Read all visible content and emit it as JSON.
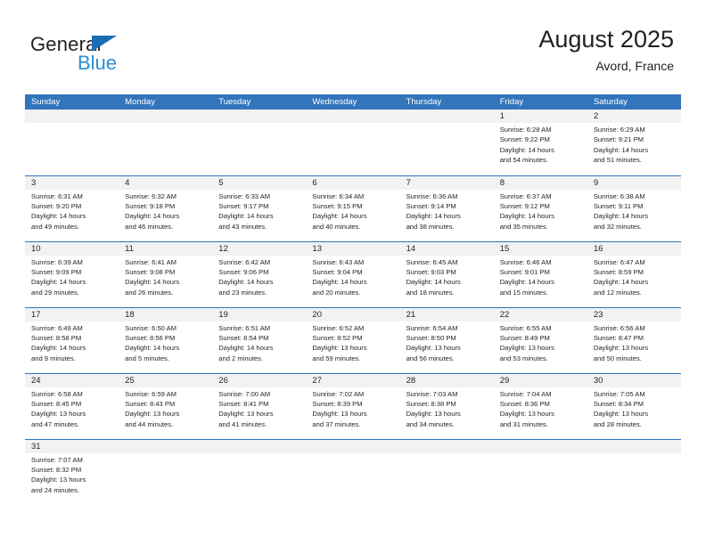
{
  "brand": {
    "name_part1": "General",
    "name_part2": "Blue",
    "accent_color": "#2b8fd4",
    "flag_color": "#1b6cb3"
  },
  "header": {
    "title": "August 2025",
    "subtitle": "Avord, France",
    "header_bg_color": "#3275bb",
    "daynum_band_color": "#f2f2f2"
  },
  "weekday_headers": [
    "Sunday",
    "Monday",
    "Tuesday",
    "Wednesday",
    "Thursday",
    "Friday",
    "Saturday"
  ],
  "weeks": [
    [
      {
        "day": "",
        "empty": true,
        "sunrise": "",
        "sunset": "",
        "daylight_line1": "",
        "daylight_line2": ""
      },
      {
        "day": "",
        "empty": true,
        "sunrise": "",
        "sunset": "",
        "daylight_line1": "",
        "daylight_line2": ""
      },
      {
        "day": "",
        "empty": true,
        "sunrise": "",
        "sunset": "",
        "daylight_line1": "",
        "daylight_line2": ""
      },
      {
        "day": "",
        "empty": true,
        "sunrise": "",
        "sunset": "",
        "daylight_line1": "",
        "daylight_line2": ""
      },
      {
        "day": "",
        "empty": true,
        "sunrise": "",
        "sunset": "",
        "daylight_line1": "",
        "daylight_line2": ""
      },
      {
        "day": "1",
        "empty": false,
        "sunrise": "Sunrise: 6:28 AM",
        "sunset": "Sunset: 9:22 PM",
        "daylight_line1": "Daylight: 14 hours",
        "daylight_line2": "and 54 minutes."
      },
      {
        "day": "2",
        "empty": false,
        "sunrise": "Sunrise: 6:29 AM",
        "sunset": "Sunset: 9:21 PM",
        "daylight_line1": "Daylight: 14 hours",
        "daylight_line2": "and 51 minutes."
      }
    ],
    [
      {
        "day": "3",
        "empty": false,
        "sunrise": "Sunrise: 6:31 AM",
        "sunset": "Sunset: 9:20 PM",
        "daylight_line1": "Daylight: 14 hours",
        "daylight_line2": "and 49 minutes."
      },
      {
        "day": "4",
        "empty": false,
        "sunrise": "Sunrise: 6:32 AM",
        "sunset": "Sunset: 9:18 PM",
        "daylight_line1": "Daylight: 14 hours",
        "daylight_line2": "and 46 minutes."
      },
      {
        "day": "5",
        "empty": false,
        "sunrise": "Sunrise: 6:33 AM",
        "sunset": "Sunset: 9:17 PM",
        "daylight_line1": "Daylight: 14 hours",
        "daylight_line2": "and 43 minutes."
      },
      {
        "day": "6",
        "empty": false,
        "sunrise": "Sunrise: 6:34 AM",
        "sunset": "Sunset: 9:15 PM",
        "daylight_line1": "Daylight: 14 hours",
        "daylight_line2": "and 40 minutes."
      },
      {
        "day": "7",
        "empty": false,
        "sunrise": "Sunrise: 6:36 AM",
        "sunset": "Sunset: 9:14 PM",
        "daylight_line1": "Daylight: 14 hours",
        "daylight_line2": "and 38 minutes."
      },
      {
        "day": "8",
        "empty": false,
        "sunrise": "Sunrise: 6:37 AM",
        "sunset": "Sunset: 9:12 PM",
        "daylight_line1": "Daylight: 14 hours",
        "daylight_line2": "and 35 minutes."
      },
      {
        "day": "9",
        "empty": false,
        "sunrise": "Sunrise: 6:38 AM",
        "sunset": "Sunset: 9:11 PM",
        "daylight_line1": "Daylight: 14 hours",
        "daylight_line2": "and 32 minutes."
      }
    ],
    [
      {
        "day": "10",
        "empty": false,
        "sunrise": "Sunrise: 6:39 AM",
        "sunset": "Sunset: 9:09 PM",
        "daylight_line1": "Daylight: 14 hours",
        "daylight_line2": "and 29 minutes."
      },
      {
        "day": "11",
        "empty": false,
        "sunrise": "Sunrise: 6:41 AM",
        "sunset": "Sunset: 9:08 PM",
        "daylight_line1": "Daylight: 14 hours",
        "daylight_line2": "and 26 minutes."
      },
      {
        "day": "12",
        "empty": false,
        "sunrise": "Sunrise: 6:42 AM",
        "sunset": "Sunset: 9:06 PM",
        "daylight_line1": "Daylight: 14 hours",
        "daylight_line2": "and 23 minutes."
      },
      {
        "day": "13",
        "empty": false,
        "sunrise": "Sunrise: 6:43 AM",
        "sunset": "Sunset: 9:04 PM",
        "daylight_line1": "Daylight: 14 hours",
        "daylight_line2": "and 20 minutes."
      },
      {
        "day": "14",
        "empty": false,
        "sunrise": "Sunrise: 6:45 AM",
        "sunset": "Sunset: 9:03 PM",
        "daylight_line1": "Daylight: 14 hours",
        "daylight_line2": "and 18 minutes."
      },
      {
        "day": "15",
        "empty": false,
        "sunrise": "Sunrise: 6:46 AM",
        "sunset": "Sunset: 9:01 PM",
        "daylight_line1": "Daylight: 14 hours",
        "daylight_line2": "and 15 minutes."
      },
      {
        "day": "16",
        "empty": false,
        "sunrise": "Sunrise: 6:47 AM",
        "sunset": "Sunset: 8:59 PM",
        "daylight_line1": "Daylight: 14 hours",
        "daylight_line2": "and 12 minutes."
      }
    ],
    [
      {
        "day": "17",
        "empty": false,
        "sunrise": "Sunrise: 6:49 AM",
        "sunset": "Sunset: 8:58 PM",
        "daylight_line1": "Daylight: 14 hours",
        "daylight_line2": "and 9 minutes."
      },
      {
        "day": "18",
        "empty": false,
        "sunrise": "Sunrise: 6:50 AM",
        "sunset": "Sunset: 8:56 PM",
        "daylight_line1": "Daylight: 14 hours",
        "daylight_line2": "and 5 minutes."
      },
      {
        "day": "19",
        "empty": false,
        "sunrise": "Sunrise: 6:51 AM",
        "sunset": "Sunset: 8:54 PM",
        "daylight_line1": "Daylight: 14 hours",
        "daylight_line2": "and 2 minutes."
      },
      {
        "day": "20",
        "empty": false,
        "sunrise": "Sunrise: 6:52 AM",
        "sunset": "Sunset: 8:52 PM",
        "daylight_line1": "Daylight: 13 hours",
        "daylight_line2": "and 59 minutes."
      },
      {
        "day": "21",
        "empty": false,
        "sunrise": "Sunrise: 6:54 AM",
        "sunset": "Sunset: 8:50 PM",
        "daylight_line1": "Daylight: 13 hours",
        "daylight_line2": "and 56 minutes."
      },
      {
        "day": "22",
        "empty": false,
        "sunrise": "Sunrise: 6:55 AM",
        "sunset": "Sunset: 8:49 PM",
        "daylight_line1": "Daylight: 13 hours",
        "daylight_line2": "and 53 minutes."
      },
      {
        "day": "23",
        "empty": false,
        "sunrise": "Sunrise: 6:56 AM",
        "sunset": "Sunset: 8:47 PM",
        "daylight_line1": "Daylight: 13 hours",
        "daylight_line2": "and 50 minutes."
      }
    ],
    [
      {
        "day": "24",
        "empty": false,
        "sunrise": "Sunrise: 6:58 AM",
        "sunset": "Sunset: 8:45 PM",
        "daylight_line1": "Daylight: 13 hours",
        "daylight_line2": "and 47 minutes."
      },
      {
        "day": "25",
        "empty": false,
        "sunrise": "Sunrise: 6:59 AM",
        "sunset": "Sunset: 8:43 PM",
        "daylight_line1": "Daylight: 13 hours",
        "daylight_line2": "and 44 minutes."
      },
      {
        "day": "26",
        "empty": false,
        "sunrise": "Sunrise: 7:00 AM",
        "sunset": "Sunset: 8:41 PM",
        "daylight_line1": "Daylight: 13 hours",
        "daylight_line2": "and 41 minutes."
      },
      {
        "day": "27",
        "empty": false,
        "sunrise": "Sunrise: 7:02 AM",
        "sunset": "Sunset: 8:39 PM",
        "daylight_line1": "Daylight: 13 hours",
        "daylight_line2": "and 37 minutes."
      },
      {
        "day": "28",
        "empty": false,
        "sunrise": "Sunrise: 7:03 AM",
        "sunset": "Sunset: 8:38 PM",
        "daylight_line1": "Daylight: 13 hours",
        "daylight_line2": "and 34 minutes."
      },
      {
        "day": "29",
        "empty": false,
        "sunrise": "Sunrise: 7:04 AM",
        "sunset": "Sunset: 8:36 PM",
        "daylight_line1": "Daylight: 13 hours",
        "daylight_line2": "and 31 minutes."
      },
      {
        "day": "30",
        "empty": false,
        "sunrise": "Sunrise: 7:05 AM",
        "sunset": "Sunset: 8:34 PM",
        "daylight_line1": "Daylight: 13 hours",
        "daylight_line2": "and 28 minutes."
      }
    ],
    [
      {
        "day": "31",
        "empty": false,
        "sunrise": "Sunrise: 7:07 AM",
        "sunset": "Sunset: 8:32 PM",
        "daylight_line1": "Daylight: 13 hours",
        "daylight_line2": "and 24 minutes."
      },
      {
        "day": "",
        "empty": true,
        "sunrise": "",
        "sunset": "",
        "daylight_line1": "",
        "daylight_line2": ""
      },
      {
        "day": "",
        "empty": true,
        "sunrise": "",
        "sunset": "",
        "daylight_line1": "",
        "daylight_line2": ""
      },
      {
        "day": "",
        "empty": true,
        "sunrise": "",
        "sunset": "",
        "daylight_line1": "",
        "daylight_line2": ""
      },
      {
        "day": "",
        "empty": true,
        "sunrise": "",
        "sunset": "",
        "daylight_line1": "",
        "daylight_line2": ""
      },
      {
        "day": "",
        "empty": true,
        "sunrise": "",
        "sunset": "",
        "daylight_line1": "",
        "daylight_line2": ""
      },
      {
        "day": "",
        "empty": true,
        "sunrise": "",
        "sunset": "",
        "daylight_line1": "",
        "daylight_line2": ""
      }
    ]
  ]
}
